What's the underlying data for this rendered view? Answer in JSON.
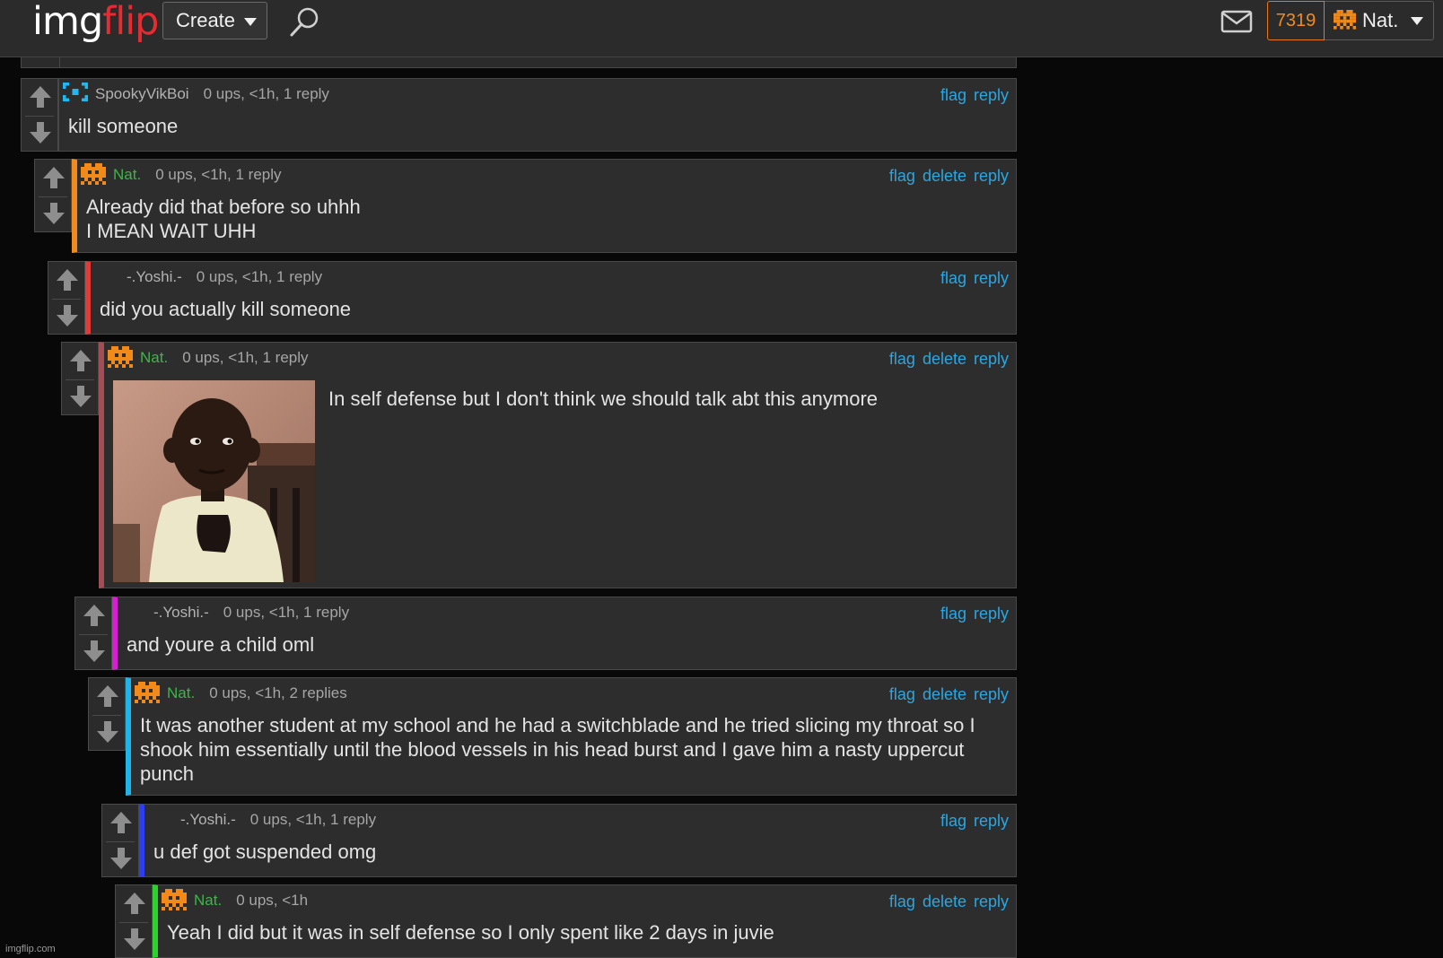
{
  "header": {
    "logo_main": "img",
    "logo_accent": "flip",
    "create_label": "Create",
    "points": "7319",
    "username": "Nat."
  },
  "comments": [
    {
      "user": "SpookyVikBoi",
      "meta": "0 ups, <1h, 1 reply",
      "actions": [
        "flag",
        "reply"
      ],
      "text": "kill someone",
      "bar_color": "",
      "avatar": "spooky-avatar"
    },
    {
      "user": "Nat.",
      "meta": "0 ups, <1h, 1 reply",
      "actions": [
        "flag",
        "delete",
        "reply"
      ],
      "text": "Already did that before so uhhh\nI MEAN WAIT UHH",
      "bar_color": "#f08c1e",
      "avatar": "invader-avatar"
    },
    {
      "user": "-.Yoshi.-",
      "meta": "0 ups, <1h, 1 reply",
      "actions": [
        "flag",
        "reply"
      ],
      "text": "did you actually kill someone",
      "bar_color": "#e23b37",
      "avatar": ""
    },
    {
      "user": "Nat.",
      "meta": "0 ups, <1h, 1 reply",
      "actions": [
        "flag",
        "delete",
        "reply"
      ],
      "text": "In self defense but I don't think we should talk abt this anymore",
      "bar_color": "#a14e54",
      "avatar": "invader-avatar",
      "image": "kid-meme-image"
    },
    {
      "user": "-.Yoshi.-",
      "meta": "0 ups, <1h, 1 reply",
      "actions": [
        "flag",
        "reply"
      ],
      "text": "and youre a child oml",
      "bar_color": "#d51fd0",
      "avatar": ""
    },
    {
      "user": "Nat.",
      "meta": "0 ups, <1h, 2 replies",
      "actions": [
        "flag",
        "delete",
        "reply"
      ],
      "text": "It was another student at my school and he had a switchblade and he tried slicing my throat so I shook him essentially until the blood vessels in his head burst and I gave him a nasty uppercut punch",
      "bar_color": "#1fb5e8",
      "avatar": "invader-avatar"
    },
    {
      "user": "-.Yoshi.-",
      "meta": "0 ups, <1h, 1 reply",
      "actions": [
        "flag",
        "reply"
      ],
      "text": "u def got suspended omg",
      "bar_color": "#2c3ef2",
      "avatar": ""
    },
    {
      "user": "Nat.",
      "meta": "0 ups, <1h",
      "actions": [
        "flag",
        "delete",
        "reply"
      ],
      "text": "Yeah I did but it was in self defense so I only spent like 2 days in juvie",
      "bar_color": "#2fd12f",
      "avatar": "invader-avatar"
    }
  ],
  "footer": {
    "watermark": "imgflip.com"
  },
  "colors": {
    "header_bg": "#2b2b2b",
    "comment_bg": "#2d2d2d",
    "link": "#2aa7e2",
    "op_name": "#3fb44b",
    "points": "#f08a24"
  }
}
